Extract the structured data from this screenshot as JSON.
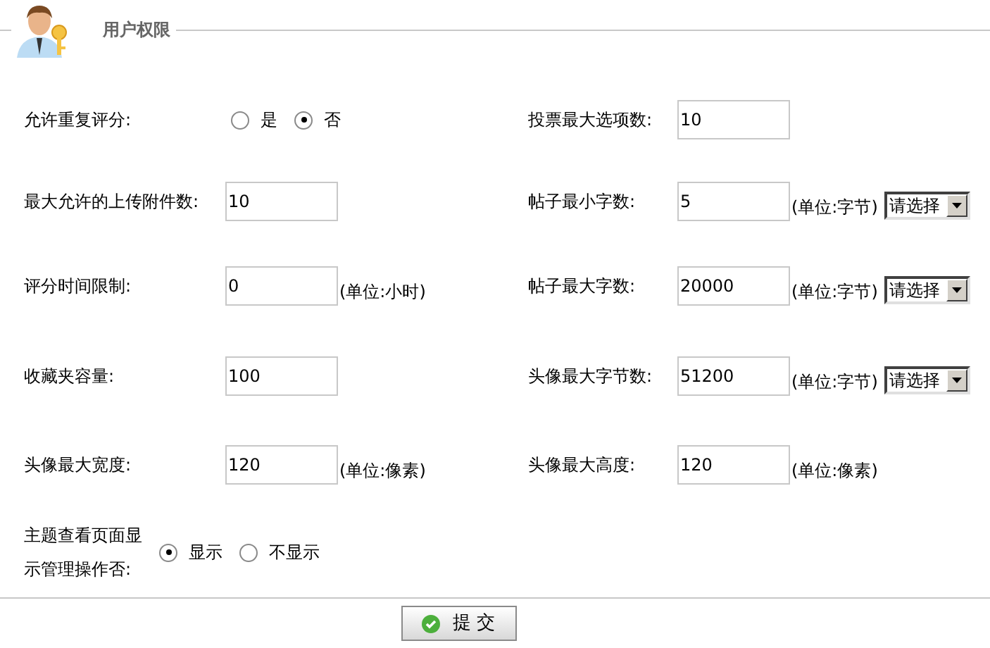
{
  "section": {
    "title": "用户权限"
  },
  "rows": [
    {
      "left": {
        "kind": "radio",
        "label": "允许重复评分:",
        "options": [
          {
            "label": "是",
            "selected": false
          },
          {
            "label": "否",
            "selected": true
          }
        ]
      },
      "right": {
        "kind": "text",
        "label": "投票最大选项数:",
        "value": "10"
      }
    },
    {
      "left": {
        "kind": "text",
        "label": "最大允许的上传附件数:",
        "value": "10"
      },
      "right": {
        "kind": "text",
        "label": "帖子最小字数:",
        "value": "5",
        "unit": "(单位:字节)",
        "select": "请选择"
      }
    },
    {
      "left": {
        "kind": "text",
        "label": "评分时间限制:",
        "value": "0",
        "unit": "(单位:小时)"
      },
      "right": {
        "kind": "text",
        "label": "帖子最大字数:",
        "value": "20000",
        "unit": "(单位:字节)",
        "select": "请选择"
      }
    },
    {
      "left": {
        "kind": "text",
        "label": "收藏夹容量:",
        "value": "100"
      },
      "right": {
        "kind": "text",
        "label": "头像最大字节数:",
        "value": "51200",
        "unit": "(单位:字节)",
        "select": "请选择"
      }
    },
    {
      "left": {
        "kind": "text",
        "label": "头像最大宽度:",
        "value": "120",
        "unit": "(单位:像素)"
      },
      "right": {
        "kind": "text",
        "label": "头像最大高度:",
        "value": "120",
        "unit": "(单位:像素)"
      }
    },
    {
      "left": {
        "kind": "radio",
        "label": "主题查看页面显示管理操作否:",
        "options": [
          {
            "label": "显示",
            "selected": true
          },
          {
            "label": "不显示",
            "selected": false
          }
        ]
      }
    }
  ],
  "submit": {
    "label": "提 交"
  }
}
